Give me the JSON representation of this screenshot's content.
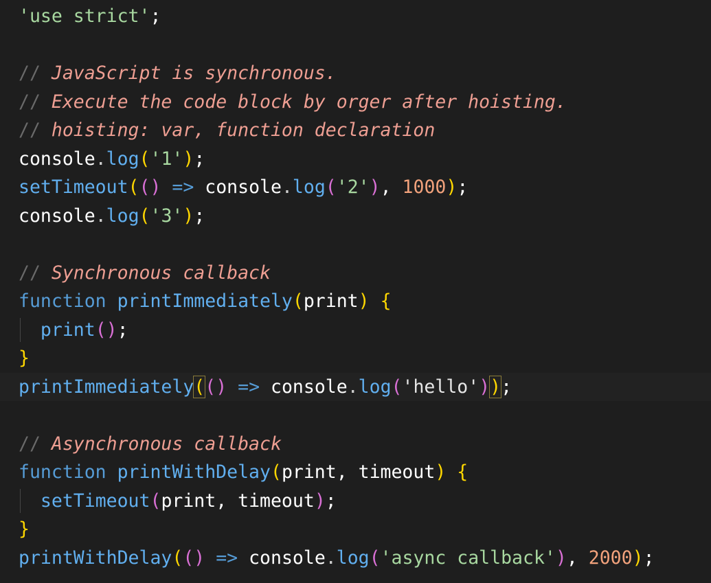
{
  "editor": {
    "lines": [
      {
        "tokens": [
          {
            "t": "'use strict'",
            "c": "str-g"
          },
          {
            "t": ";",
            "c": "id"
          }
        ]
      },
      {
        "tokens": []
      },
      {
        "tokens": [
          {
            "t": "// ",
            "c": "cmt-slash"
          },
          {
            "t": "JavaScript is synchronous.",
            "c": "cmt"
          }
        ]
      },
      {
        "tokens": [
          {
            "t": "// ",
            "c": "cmt-slash"
          },
          {
            "t": "Execute the code block by orger after hoisting.",
            "c": "cmt"
          }
        ]
      },
      {
        "tokens": [
          {
            "t": "// ",
            "c": "cmt-slash"
          },
          {
            "t": "hoisting: var, function declaration",
            "c": "cmt"
          }
        ]
      },
      {
        "tokens": [
          {
            "t": "console",
            "c": "id"
          },
          {
            "t": ".",
            "c": "dot"
          },
          {
            "t": "log",
            "c": "fn"
          },
          {
            "t": "(",
            "c": "p1"
          },
          {
            "t": "'1'",
            "c": "str-g"
          },
          {
            "t": ")",
            "c": "p1"
          },
          {
            "t": ";",
            "c": "id"
          }
        ]
      },
      {
        "tokens": [
          {
            "t": "setTimeout",
            "c": "fn"
          },
          {
            "t": "(",
            "c": "p1"
          },
          {
            "t": "()",
            "c": "p2"
          },
          {
            "t": " => ",
            "c": "op"
          },
          {
            "t": "console",
            "c": "id"
          },
          {
            "t": ".",
            "c": "dot"
          },
          {
            "t": "log",
            "c": "fn"
          },
          {
            "t": "(",
            "c": "p2"
          },
          {
            "t": "'2'",
            "c": "str-g"
          },
          {
            "t": ")",
            "c": "p2"
          },
          {
            "t": ", ",
            "c": "id"
          },
          {
            "t": "1000",
            "c": "num"
          },
          {
            "t": ")",
            "c": "p1"
          },
          {
            "t": ";",
            "c": "id"
          }
        ]
      },
      {
        "tokens": [
          {
            "t": "console",
            "c": "id"
          },
          {
            "t": ".",
            "c": "dot"
          },
          {
            "t": "log",
            "c": "fn"
          },
          {
            "t": "(",
            "c": "p1"
          },
          {
            "t": "'3'",
            "c": "str-g"
          },
          {
            "t": ")",
            "c": "p1"
          },
          {
            "t": ";",
            "c": "id"
          }
        ]
      },
      {
        "tokens": []
      },
      {
        "tokens": [
          {
            "t": "// ",
            "c": "cmt-slash"
          },
          {
            "t": "Synchronous callback",
            "c": "cmt"
          }
        ]
      },
      {
        "tokens": [
          {
            "t": "function ",
            "c": "kw"
          },
          {
            "t": "printImmediately",
            "c": "fn"
          },
          {
            "t": "(",
            "c": "p1"
          },
          {
            "t": "print",
            "c": "id"
          },
          {
            "t": ")",
            "c": "p1"
          },
          {
            "t": " ",
            "c": "id"
          },
          {
            "t": "{",
            "c": "p1"
          }
        ]
      },
      {
        "tokens": [
          {
            "t": "  ",
            "c": "id"
          },
          {
            "t": "print",
            "c": "fn"
          },
          {
            "t": "()",
            "c": "p2"
          },
          {
            "t": ";",
            "c": "id"
          }
        ],
        "guide": true
      },
      {
        "tokens": [
          {
            "t": "}",
            "c": "p1"
          }
        ]
      },
      {
        "tokens": [
          {
            "t": "printImmediately",
            "c": "fn"
          },
          {
            "t": "(",
            "c": "p1 bracket-hl"
          },
          {
            "t": "()",
            "c": "p2"
          },
          {
            "t": " => ",
            "c": "op"
          },
          {
            "t": "console",
            "c": "id"
          },
          {
            "t": ".",
            "c": "dot"
          },
          {
            "t": "log",
            "c": "fn"
          },
          {
            "t": "(",
            "c": "p2"
          },
          {
            "t": "'hello'",
            "c": "str-plain"
          },
          {
            "t": ")",
            "c": "p2"
          },
          {
            "t": ")",
            "c": "p1 bracket-hl"
          },
          {
            "t": ";",
            "c": "id"
          }
        ],
        "current": true
      },
      {
        "tokens": []
      },
      {
        "tokens": [
          {
            "t": "// ",
            "c": "cmt-slash"
          },
          {
            "t": "Asynchronous callback",
            "c": "cmt"
          }
        ]
      },
      {
        "tokens": [
          {
            "t": "function ",
            "c": "kw"
          },
          {
            "t": "printWithDelay",
            "c": "fn"
          },
          {
            "t": "(",
            "c": "p1"
          },
          {
            "t": "print, timeout",
            "c": "id"
          },
          {
            "t": ")",
            "c": "p1"
          },
          {
            "t": " ",
            "c": "id"
          },
          {
            "t": "{",
            "c": "p1"
          }
        ]
      },
      {
        "tokens": [
          {
            "t": "  ",
            "c": "id"
          },
          {
            "t": "setTimeout",
            "c": "fn"
          },
          {
            "t": "(",
            "c": "p2"
          },
          {
            "t": "print, timeout",
            "c": "id"
          },
          {
            "t": ")",
            "c": "p2"
          },
          {
            "t": ";",
            "c": "id"
          }
        ],
        "guide": true
      },
      {
        "tokens": [
          {
            "t": "}",
            "c": "p1"
          }
        ]
      },
      {
        "tokens": [
          {
            "t": "printWithDelay",
            "c": "fn"
          },
          {
            "t": "(",
            "c": "p1"
          },
          {
            "t": "()",
            "c": "p2"
          },
          {
            "t": " => ",
            "c": "op"
          },
          {
            "t": "console",
            "c": "id"
          },
          {
            "t": ".",
            "c": "dot"
          },
          {
            "t": "log",
            "c": "fn"
          },
          {
            "t": "(",
            "c": "p2"
          },
          {
            "t": "'async callback'",
            "c": "str-g"
          },
          {
            "t": ")",
            "c": "p2"
          },
          {
            "t": ", ",
            "c": "id"
          },
          {
            "t": "2000",
            "c": "num"
          },
          {
            "t": ")",
            "c": "p1"
          },
          {
            "t": ";",
            "c": "id"
          }
        ]
      }
    ]
  }
}
